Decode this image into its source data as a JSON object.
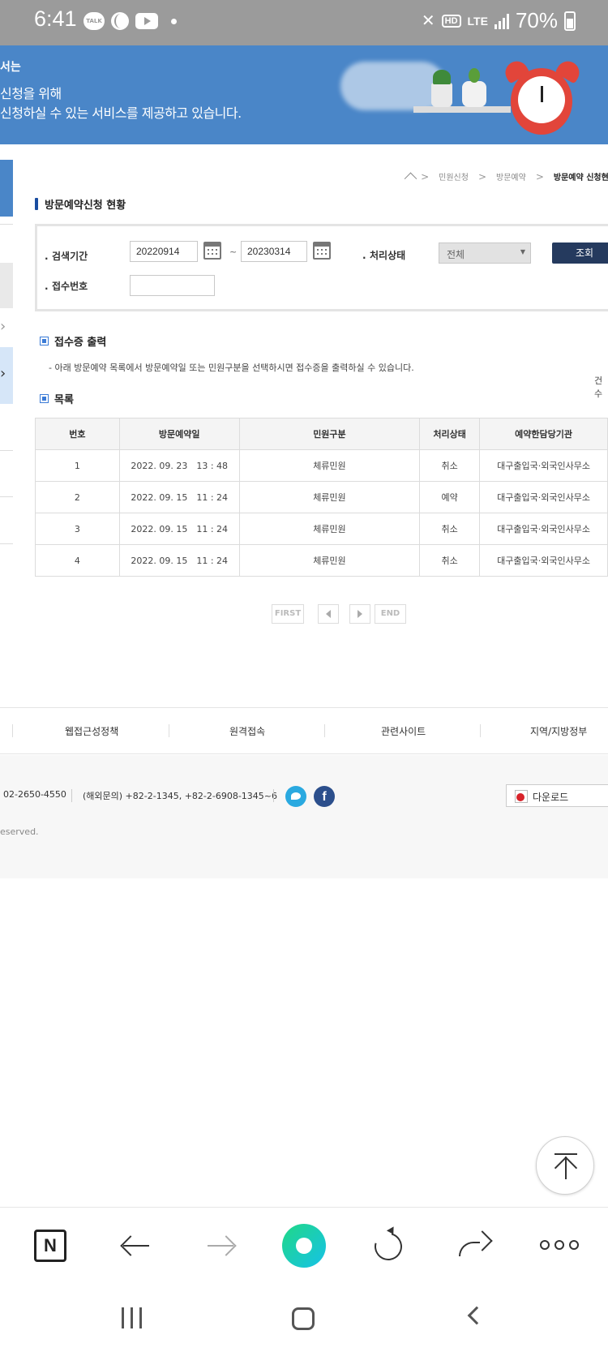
{
  "status_bar": {
    "time": "6:41",
    "talk_label": "TALK",
    "network": "LTE",
    "hd_label": "HD",
    "battery": "70%"
  },
  "banner": {
    "line1": "서는",
    "line2": "신청을 위해",
    "line3": "신청하실 수 있는 서비스를 제공하고 있습니다."
  },
  "breadcrumb": {
    "items": [
      "민원신청",
      "방문예약"
    ],
    "current": "방문예약 신청현황",
    "separator": ">"
  },
  "page_title": "방문예약신청 현황",
  "search": {
    "period_label": "검색기간",
    "date_from": "20220914",
    "date_to": "20230314",
    "tilde": "~",
    "status_label": "처리상태",
    "status_value": "전체",
    "receipt_label": "접수번호",
    "receipt_value": "",
    "search_button": "조회"
  },
  "receipt_section": {
    "title": "접수증 출력",
    "description": "- 아래 방문예약 목록에서 방문예약일 또는 민원구분을 선택하시면 접수증을 출력하실 수 있습니다.",
    "count_label": "건수"
  },
  "list_section": {
    "title": "목록",
    "columns": [
      "번호",
      "방문예약일",
      "민원구분",
      "처리상태",
      "예약한담당기관"
    ],
    "rows": [
      {
        "no": "1",
        "date": "2022. 09. 23　13 : 48",
        "type": "체류민원",
        "status": "취소",
        "office": "대구출입국·외국인사무소"
      },
      {
        "no": "2",
        "date": "2022. 09. 15　11 : 24",
        "type": "체류민원",
        "status": "예약",
        "office": "대구출입국·외국인사무소"
      },
      {
        "no": "3",
        "date": "2022. 09. 15　11 : 24",
        "type": "체류민원",
        "status": "취소",
        "office": "대구출입국·외국인사무소"
      },
      {
        "no": "4",
        "date": "2022. 09. 15　11 : 24",
        "type": "체류민원",
        "status": "취소",
        "office": "대구출입국·외국인사무소"
      }
    ]
  },
  "pagination": {
    "first": "FIRST",
    "end": "END"
  },
  "footer": {
    "links": [
      "웹접근성정책",
      "원격접속",
      "관련사이트",
      "지역/지방정부"
    ],
    "phone": "02-2650-4550",
    "intl_phone": "(해외문의) +82-2-1345, +82-2-6908-1345~6",
    "facebook_letter": "f",
    "download_label": "다운로드",
    "copyright": "eserved."
  },
  "browser": {
    "n_label": "N"
  },
  "colors": {
    "banner_blue": "#4a86c8",
    "search_button": "#253a5e",
    "title_marker": "#1a4da0",
    "twitter": "#2aa9e0",
    "facebook": "#2c4f8c"
  }
}
